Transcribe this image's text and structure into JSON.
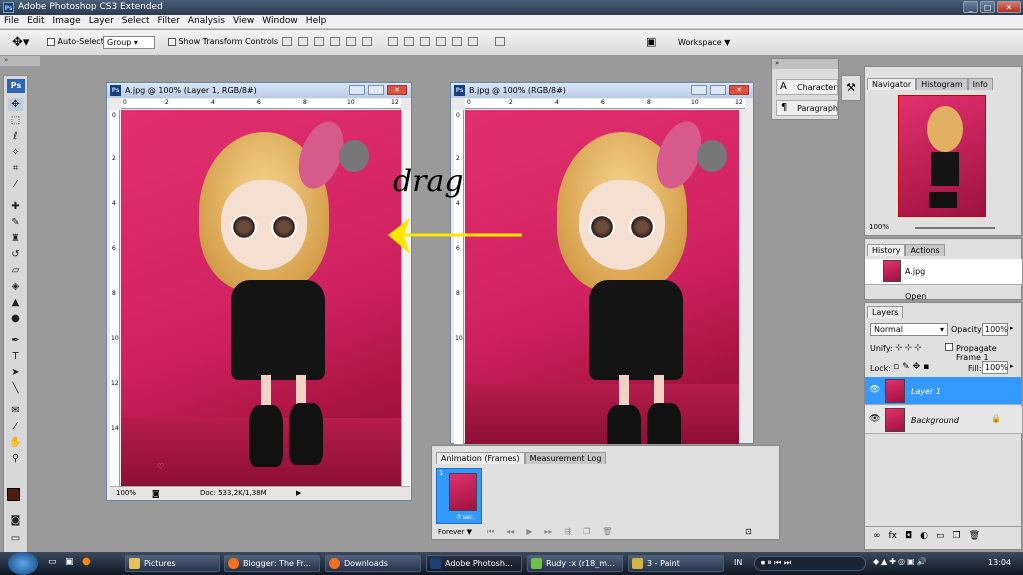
{
  "window": {
    "title": "Adobe Photoshop CS3 Extended"
  },
  "menu": [
    "File",
    "Edit",
    "Image",
    "Layer",
    "Select",
    "Filter",
    "Analysis",
    "View",
    "Window",
    "Help"
  ],
  "options": {
    "auto_select_label": "Auto-Select:",
    "auto_select_value": "Group",
    "transform_label": "Show Transform Controls",
    "workspace_label": "Workspace ▼"
  },
  "doc_a": {
    "title": "A.jpg @ 100% (Layer 1, RGB/8#)",
    "zoom": "100%",
    "doc_info": "Doc: 533,2K/1,38M",
    "ruler_h": [
      "0",
      "2",
      "4",
      "6",
      "8",
      "10",
      "12"
    ],
    "ruler_v": [
      "0",
      "2",
      "4",
      "6",
      "8",
      "10",
      "12",
      "14"
    ]
  },
  "doc_b": {
    "title": "B.jpg @ 100% (RGB/8#)",
    "ruler_h": [
      "0",
      "2",
      "4",
      "6",
      "8",
      "10",
      "12"
    ],
    "ruler_v": [
      "0",
      "2",
      "4",
      "6",
      "8",
      "10"
    ]
  },
  "annotation": {
    "text": "drag"
  },
  "char_panel": {
    "character": "Character",
    "paragraph": "Paragraph"
  },
  "navigator": {
    "tabs": [
      "Navigator",
      "Histogram",
      "Info"
    ],
    "zoom": "100%"
  },
  "history": {
    "tabs": [
      "History",
      "Actions"
    ],
    "items": [
      "A.jpg",
      "Open"
    ]
  },
  "layers": {
    "tab": "Layers",
    "blend_mode": "Normal",
    "opacity_label": "Opacity:",
    "opacity": "100%",
    "unify_label": "Unify:",
    "propagate_label": "Propagate Frame 1",
    "lock_label": "Lock:",
    "fill_label": "Fill:",
    "fill": "100%",
    "rows": [
      "Layer 1",
      "Background"
    ]
  },
  "animation": {
    "tabs": [
      "Animation (Frames)",
      "Measurement Log"
    ],
    "frame_number": "1",
    "frame_delay": "0 sec.",
    "loop": "Forever ▼"
  },
  "taskbar": {
    "items": [
      "Pictures",
      "Blogger: The Fr...",
      "Downloads",
      "Adobe Photosh...",
      "Rudy :x (r18_m...",
      "3 - Paint"
    ],
    "lang": "IN",
    "time": "13:04"
  },
  "colors": {
    "accent": "#3399ff",
    "title": "#2b3a4e",
    "fg_swatch": "#4a1e0e"
  }
}
